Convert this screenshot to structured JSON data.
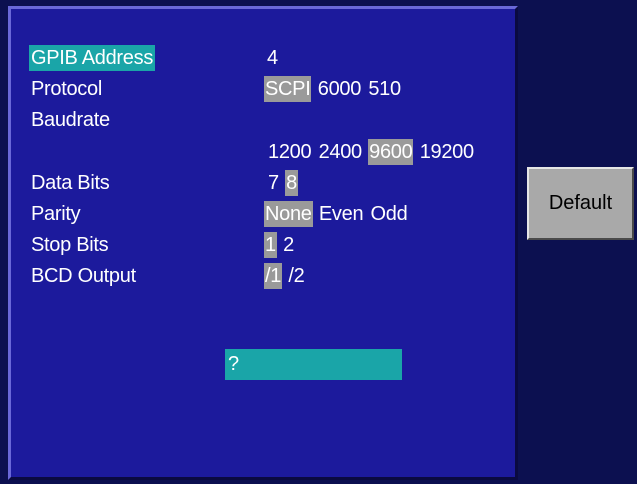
{
  "settings": {
    "gpib_address": {
      "label": "GPIB Address",
      "value": "4"
    },
    "protocol": {
      "label": "Protocol",
      "options": [
        "SCPI",
        "6000",
        "510"
      ],
      "selected": "SCPI"
    },
    "baudrate": {
      "label": "Baudrate",
      "options": [
        "1200",
        "2400",
        "9600",
        "19200"
      ],
      "selected": "9600"
    },
    "data_bits": {
      "label": "Data Bits",
      "options": [
        "7",
        "8"
      ],
      "selected": "8"
    },
    "parity": {
      "label": "Parity",
      "options": [
        "None",
        "Even",
        "Odd"
      ],
      "selected": "None"
    },
    "stop_bits": {
      "label": "Stop Bits",
      "options": [
        "1",
        "2"
      ],
      "selected": "1"
    },
    "bcd_output": {
      "label": "BCD Output",
      "options": [
        "/1",
        "/2"
      ],
      "selected": "/1"
    }
  },
  "command_input": {
    "value": "?"
  },
  "side": {
    "default_label": "Default"
  },
  "colors": {
    "panel": "#1c1a9c",
    "background": "#0c1050",
    "highlight": "#1aa5a8",
    "selection": "#9a9a9a",
    "button": "#a9a9a9"
  }
}
